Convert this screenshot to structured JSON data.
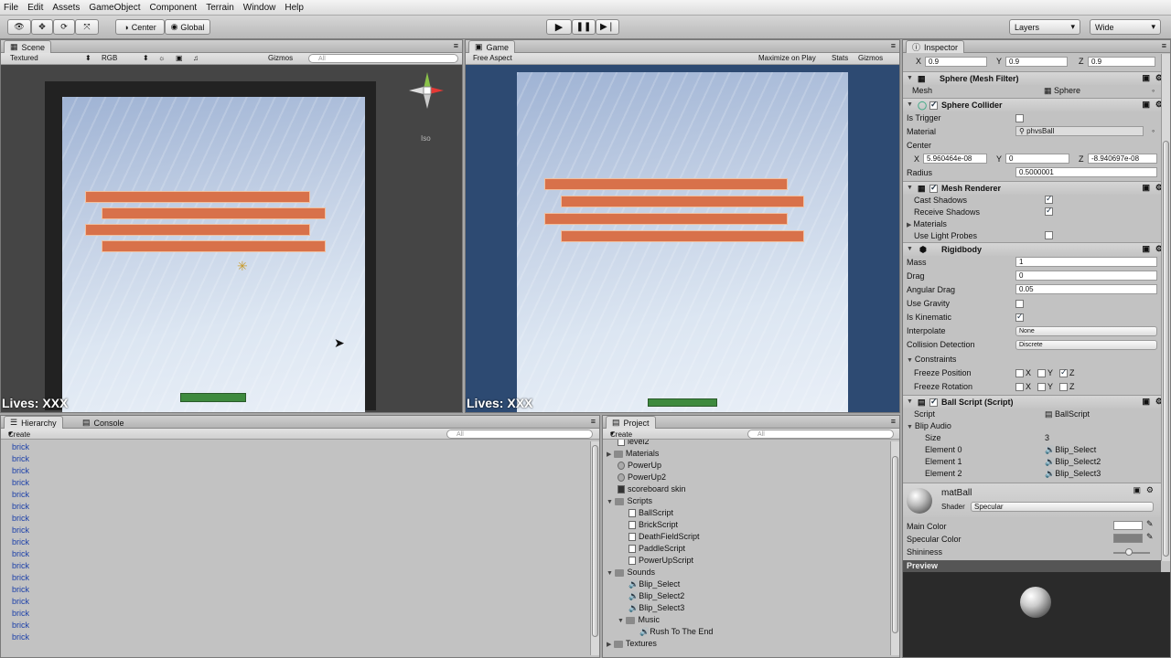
{
  "menu": [
    "File",
    "Edit",
    "Assets",
    "GameObject",
    "Component",
    "Terrain",
    "Window",
    "Help"
  ],
  "toolbar": {
    "center_label": "Center",
    "global_label": "Global",
    "layers_label": "Layers",
    "layout_label": "Wide"
  },
  "scene": {
    "tab": "Scene",
    "render_mode": "Textured",
    "channel": "RGB",
    "gizmos": "Gizmos",
    "search": "All",
    "iso": "Iso",
    "lives": "Lives: XXX"
  },
  "game": {
    "tab": "Game",
    "aspect": "Free Aspect",
    "maximize": "Maximize on Play",
    "stats": "Stats",
    "gizmos": "Gizmos",
    "lives": "Lives: XXX"
  },
  "hierarchy": {
    "tab": "Hierarchy",
    "console_tab": "Console",
    "create": "Create",
    "search": "All",
    "items": [
      "brick",
      "brick",
      "brick",
      "brick",
      "brick",
      "brick",
      "brick",
      "brick",
      "brick",
      "brick",
      "brick",
      "brick",
      "brick",
      "brick",
      "brick",
      "brick",
      "brick"
    ]
  },
  "project": {
    "tab": "Project",
    "create": "Create",
    "search": "All",
    "items": [
      {
        "label": "level2",
        "indent": 1,
        "kind": "file"
      },
      {
        "label": "Materials",
        "indent": 0,
        "kind": "folder"
      },
      {
        "label": "PowerUp",
        "indent": 1,
        "kind": "file"
      },
      {
        "label": "PowerUp2",
        "indent": 1,
        "kind": "file"
      },
      {
        "label": "scoreboard skin",
        "indent": 1,
        "kind": "file"
      },
      {
        "label": "Scripts",
        "indent": 0,
        "kind": "folder"
      },
      {
        "label": "BallScript",
        "indent": 2,
        "kind": "script"
      },
      {
        "label": "BrickScript",
        "indent": 2,
        "kind": "script"
      },
      {
        "label": "DeathFieldScript",
        "indent": 2,
        "kind": "script"
      },
      {
        "label": "PaddleScript",
        "indent": 2,
        "kind": "script"
      },
      {
        "label": "PowerUpScript",
        "indent": 2,
        "kind": "script"
      },
      {
        "label": "Sounds",
        "indent": 0,
        "kind": "folder"
      },
      {
        "label": "Blip_Select",
        "indent": 2,
        "kind": "sound"
      },
      {
        "label": "Blip_Select2",
        "indent": 2,
        "kind": "sound"
      },
      {
        "label": "Blip_Select3",
        "indent": 2,
        "kind": "sound"
      },
      {
        "label": "Music",
        "indent": 1,
        "kind": "folder"
      },
      {
        "label": "Rush To The End",
        "indent": 3,
        "kind": "sound"
      },
      {
        "label": "Textures",
        "indent": 0,
        "kind": "folder"
      }
    ]
  },
  "inspector": {
    "tab": "Inspector",
    "scale": {
      "x": "0.9",
      "y": "0.9",
      "z": "0.9"
    },
    "mesh_filter": {
      "title": "Sphere (Mesh Filter)",
      "mesh_label": "Mesh",
      "mesh_value": "Sphere"
    },
    "sphere_collider": {
      "title": "Sphere Collider",
      "is_trigger": "Is Trigger",
      "material": "Material",
      "material_value": "phvsBall",
      "center": "Center",
      "cx": "5.960464e-08",
      "cy": "0",
      "cz": "-8.940697e-08",
      "radius": "Radius",
      "radius_value": "0.5000001"
    },
    "mesh_renderer": {
      "title": "Mesh Renderer",
      "cast": "Cast Shadows",
      "receive": "Receive Shadows",
      "materials": "Materials",
      "probes": "Use Light Probes"
    },
    "rigidbody": {
      "title": "Rigidbody",
      "mass": "Mass",
      "mass_v": "1",
      "drag": "Drag",
      "drag_v": "0",
      "angular": "Angular Drag",
      "angular_v": "0.05",
      "gravity": "Use Gravity",
      "kinematic": "Is Kinematic",
      "interpolate": "Interpolate",
      "interpolate_v": "None",
      "collision": "Collision Detection",
      "collision_v": "Discrete",
      "constraints": "Constraints",
      "freeze_pos": "Freeze Position",
      "freeze_rot": "Freeze Rotation"
    },
    "ball_script": {
      "title": "Ball Script (Script)",
      "script": "Script",
      "script_v": "BallScript",
      "blip": "Blip Audio",
      "size": "Size",
      "size_v": "3",
      "e0": "Element 0",
      "e0v": "Blip_Select",
      "e1": "Element 1",
      "e1v": "Blip_Select2",
      "e2": "Element 2",
      "e2v": "Blip_Select3"
    },
    "material": {
      "name": "matBall",
      "shader": "Shader",
      "shader_v": "Specular",
      "main_color": "Main Color",
      "spec_color": "Specular Color",
      "shininess": "Shininess",
      "preview": "Preview"
    }
  }
}
